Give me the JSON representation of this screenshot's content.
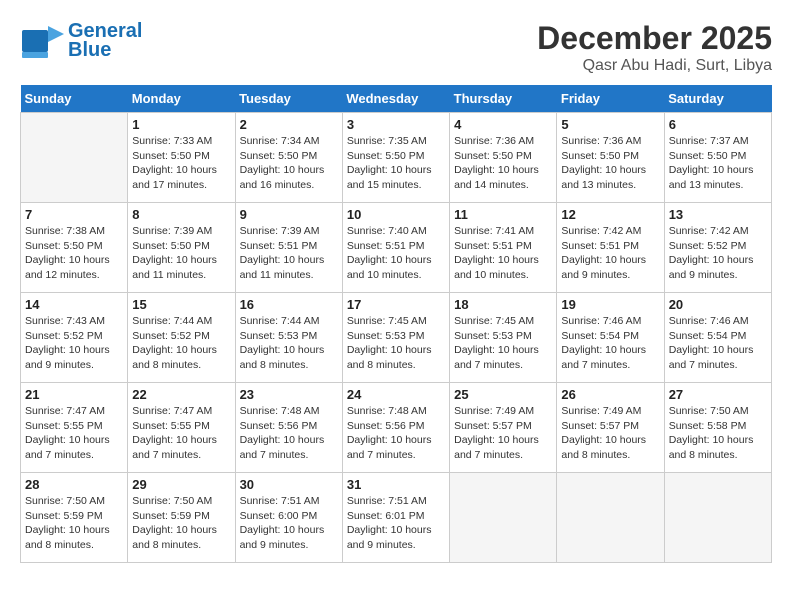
{
  "header": {
    "logo_line1": "General",
    "logo_line2": "Blue",
    "main_title": "December 2025",
    "subtitle": "Qasr Abu Hadi, Surt, Libya"
  },
  "days_of_week": [
    "Sunday",
    "Monday",
    "Tuesday",
    "Wednesday",
    "Thursday",
    "Friday",
    "Saturday"
  ],
  "weeks": [
    [
      {
        "day": "",
        "info": ""
      },
      {
        "day": "1",
        "info": "Sunrise: 7:33 AM\nSunset: 5:50 PM\nDaylight: 10 hours\nand 17 minutes."
      },
      {
        "day": "2",
        "info": "Sunrise: 7:34 AM\nSunset: 5:50 PM\nDaylight: 10 hours\nand 16 minutes."
      },
      {
        "day": "3",
        "info": "Sunrise: 7:35 AM\nSunset: 5:50 PM\nDaylight: 10 hours\nand 15 minutes."
      },
      {
        "day": "4",
        "info": "Sunrise: 7:36 AM\nSunset: 5:50 PM\nDaylight: 10 hours\nand 14 minutes."
      },
      {
        "day": "5",
        "info": "Sunrise: 7:36 AM\nSunset: 5:50 PM\nDaylight: 10 hours\nand 13 minutes."
      },
      {
        "day": "6",
        "info": "Sunrise: 7:37 AM\nSunset: 5:50 PM\nDaylight: 10 hours\nand 13 minutes."
      }
    ],
    [
      {
        "day": "7",
        "info": "Sunrise: 7:38 AM\nSunset: 5:50 PM\nDaylight: 10 hours\nand 12 minutes."
      },
      {
        "day": "8",
        "info": "Sunrise: 7:39 AM\nSunset: 5:50 PM\nDaylight: 10 hours\nand 11 minutes."
      },
      {
        "day": "9",
        "info": "Sunrise: 7:39 AM\nSunset: 5:51 PM\nDaylight: 10 hours\nand 11 minutes."
      },
      {
        "day": "10",
        "info": "Sunrise: 7:40 AM\nSunset: 5:51 PM\nDaylight: 10 hours\nand 10 minutes."
      },
      {
        "day": "11",
        "info": "Sunrise: 7:41 AM\nSunset: 5:51 PM\nDaylight: 10 hours\nand 10 minutes."
      },
      {
        "day": "12",
        "info": "Sunrise: 7:42 AM\nSunset: 5:51 PM\nDaylight: 10 hours\nand 9 minutes."
      },
      {
        "day": "13",
        "info": "Sunrise: 7:42 AM\nSunset: 5:52 PM\nDaylight: 10 hours\nand 9 minutes."
      }
    ],
    [
      {
        "day": "14",
        "info": "Sunrise: 7:43 AM\nSunset: 5:52 PM\nDaylight: 10 hours\nand 9 minutes."
      },
      {
        "day": "15",
        "info": "Sunrise: 7:44 AM\nSunset: 5:52 PM\nDaylight: 10 hours\nand 8 minutes."
      },
      {
        "day": "16",
        "info": "Sunrise: 7:44 AM\nSunset: 5:53 PM\nDaylight: 10 hours\nand 8 minutes."
      },
      {
        "day": "17",
        "info": "Sunrise: 7:45 AM\nSunset: 5:53 PM\nDaylight: 10 hours\nand 8 minutes."
      },
      {
        "day": "18",
        "info": "Sunrise: 7:45 AM\nSunset: 5:53 PM\nDaylight: 10 hours\nand 7 minutes."
      },
      {
        "day": "19",
        "info": "Sunrise: 7:46 AM\nSunset: 5:54 PM\nDaylight: 10 hours\nand 7 minutes."
      },
      {
        "day": "20",
        "info": "Sunrise: 7:46 AM\nSunset: 5:54 PM\nDaylight: 10 hours\nand 7 minutes."
      }
    ],
    [
      {
        "day": "21",
        "info": "Sunrise: 7:47 AM\nSunset: 5:55 PM\nDaylight: 10 hours\nand 7 minutes."
      },
      {
        "day": "22",
        "info": "Sunrise: 7:47 AM\nSunset: 5:55 PM\nDaylight: 10 hours\nand 7 minutes."
      },
      {
        "day": "23",
        "info": "Sunrise: 7:48 AM\nSunset: 5:56 PM\nDaylight: 10 hours\nand 7 minutes."
      },
      {
        "day": "24",
        "info": "Sunrise: 7:48 AM\nSunset: 5:56 PM\nDaylight: 10 hours\nand 7 minutes."
      },
      {
        "day": "25",
        "info": "Sunrise: 7:49 AM\nSunset: 5:57 PM\nDaylight: 10 hours\nand 7 minutes."
      },
      {
        "day": "26",
        "info": "Sunrise: 7:49 AM\nSunset: 5:57 PM\nDaylight: 10 hours\nand 8 minutes."
      },
      {
        "day": "27",
        "info": "Sunrise: 7:50 AM\nSunset: 5:58 PM\nDaylight: 10 hours\nand 8 minutes."
      }
    ],
    [
      {
        "day": "28",
        "info": "Sunrise: 7:50 AM\nSunset: 5:59 PM\nDaylight: 10 hours\nand 8 minutes."
      },
      {
        "day": "29",
        "info": "Sunrise: 7:50 AM\nSunset: 5:59 PM\nDaylight: 10 hours\nand 8 minutes."
      },
      {
        "day": "30",
        "info": "Sunrise: 7:51 AM\nSunset: 6:00 PM\nDaylight: 10 hours\nand 9 minutes."
      },
      {
        "day": "31",
        "info": "Sunrise: 7:51 AM\nSunset: 6:01 PM\nDaylight: 10 hours\nand 9 minutes."
      },
      {
        "day": "",
        "info": ""
      },
      {
        "day": "",
        "info": ""
      },
      {
        "day": "",
        "info": ""
      }
    ]
  ]
}
